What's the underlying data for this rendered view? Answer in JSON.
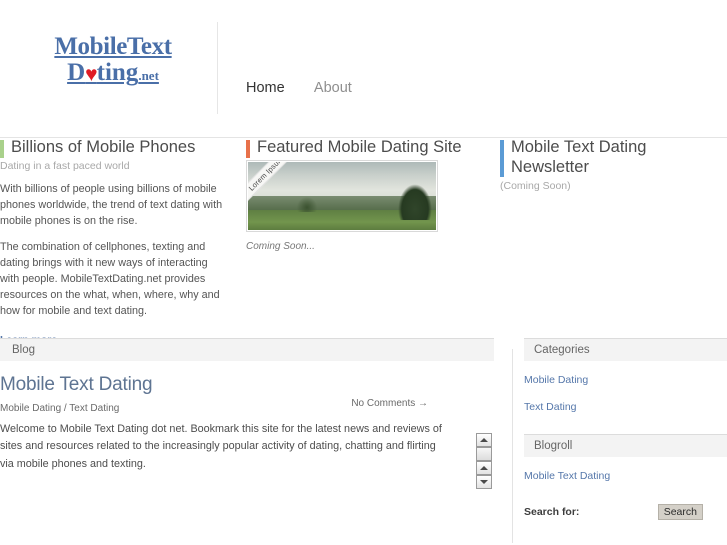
{
  "header": {
    "logo": {
      "line1": "MobileText",
      "line2_pre": "D",
      "line2_heart": "♥",
      "line2_post": "ting",
      "line2_tld": ".net"
    },
    "nav": [
      {
        "label": "Home",
        "active": true
      },
      {
        "label": "About",
        "active": false
      }
    ]
  },
  "features": [
    {
      "accent": "#a9d18b",
      "title": "Billions of Mobile Phones",
      "subtitle": "Dating in a fast paced world",
      "paragraphs": [
        "With billions of people using billions of mobile phones worldwide, the trend of text dating with mobile phones is on the rise.",
        "The combination of cellphones, texting and dating brings with it new ways of interacting with people. MobileTextDating.net provides resources on the what, when, where, why and how for mobile and text dating."
      ],
      "link": "Learn more »"
    },
    {
      "accent": "#e8714a",
      "title": "Featured Mobile Dating Site",
      "ribbon": "Lorem Ipsum",
      "caption": "Coming Soon..."
    },
    {
      "accent": "#5b9bd5",
      "title": "Mobile Text Dating Newsletter",
      "subtitle": "(Coming Soon)"
    }
  ],
  "blog": {
    "section_label": "Blog",
    "post": {
      "title": "Mobile Text Dating",
      "categories": "Mobile Dating / Text Dating",
      "comments": "No Comments →",
      "body": "Welcome to Mobile Text Dating dot net. Bookmark this site for the latest news and reviews of sites and resources related to the increasingly popular activity of dating, chatting and flirting via mobile phones and texting."
    }
  },
  "sidebar": {
    "categories": {
      "label": "Categories",
      "items": [
        "Mobile Dating",
        "Text Dating"
      ]
    },
    "blogroll": {
      "label": "Blogroll",
      "items": [
        "Mobile Text Dating"
      ]
    },
    "search": {
      "label": "Search for:",
      "button": "Search"
    }
  }
}
